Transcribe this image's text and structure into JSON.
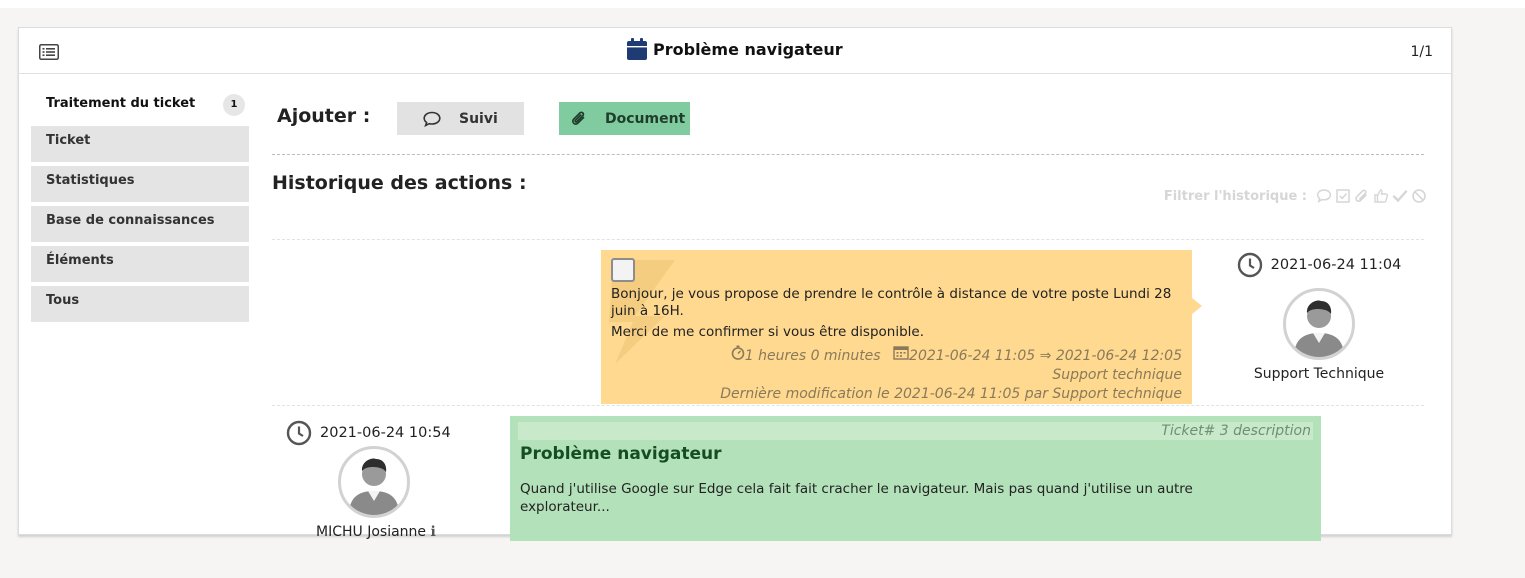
{
  "header": {
    "title": "Problème navigateur",
    "pager": "1/1"
  },
  "sidebar": {
    "active": {
      "label": "Traitement du ticket",
      "badge": "1"
    },
    "items": [
      {
        "label": "Ticket"
      },
      {
        "label": "Statistiques"
      },
      {
        "label": "Base de connaissances"
      },
      {
        "label": "Éléments"
      },
      {
        "label": "Tous"
      }
    ]
  },
  "main": {
    "add_label": "Ajouter :",
    "buttons": {
      "suivi": "Suivi",
      "document": "Document"
    },
    "history_title": "Historique des actions :",
    "filter_label": "Filtrer l'historique :"
  },
  "followup": {
    "lines": [
      "Bonjour, je vous propose de prendre le contrôle à distance de votre poste Lundi 28 juin à 16H.",
      "Merci de me confirmer si vous être disponible."
    ],
    "duration": "1 heures 0 minutes",
    "planning": "2021-06-24 11:05 ⇒ 2021-06-24 12:05",
    "author": "Support technique",
    "modified": "Dernière modification le 2021-06-24 11:05 par Support technique",
    "date": "2021-06-24 11:04",
    "user": "Support Technique"
  },
  "description": {
    "header": "Ticket# 3 description",
    "title": "Problème navigateur",
    "body": "Quand j'utilise Google sur Edge cela fait fait cracher le navigateur. Mais pas quand j'utilise un autre explorateur...",
    "date": "2021-06-24 10:54",
    "user": "MICHU Josianne",
    "info_glyph": "ℹ"
  },
  "colors": {
    "followup_bg": "#fed98f",
    "description_bg": "#b3e1b9",
    "document_button": "#80cba0",
    "title_icon": "#1f3b73"
  },
  "icons": {
    "header_left": "list-icon",
    "title": "calendar-icon",
    "suivi": "comment-icon",
    "document": "paperclip-icon",
    "date": "clock-icon",
    "duration": "stopwatch-icon",
    "planning": "calendar-icon",
    "filters": [
      "comment-icon",
      "task-icon",
      "paperclip-icon",
      "thumbs-up-icon",
      "check-icon",
      "ban-icon"
    ]
  }
}
